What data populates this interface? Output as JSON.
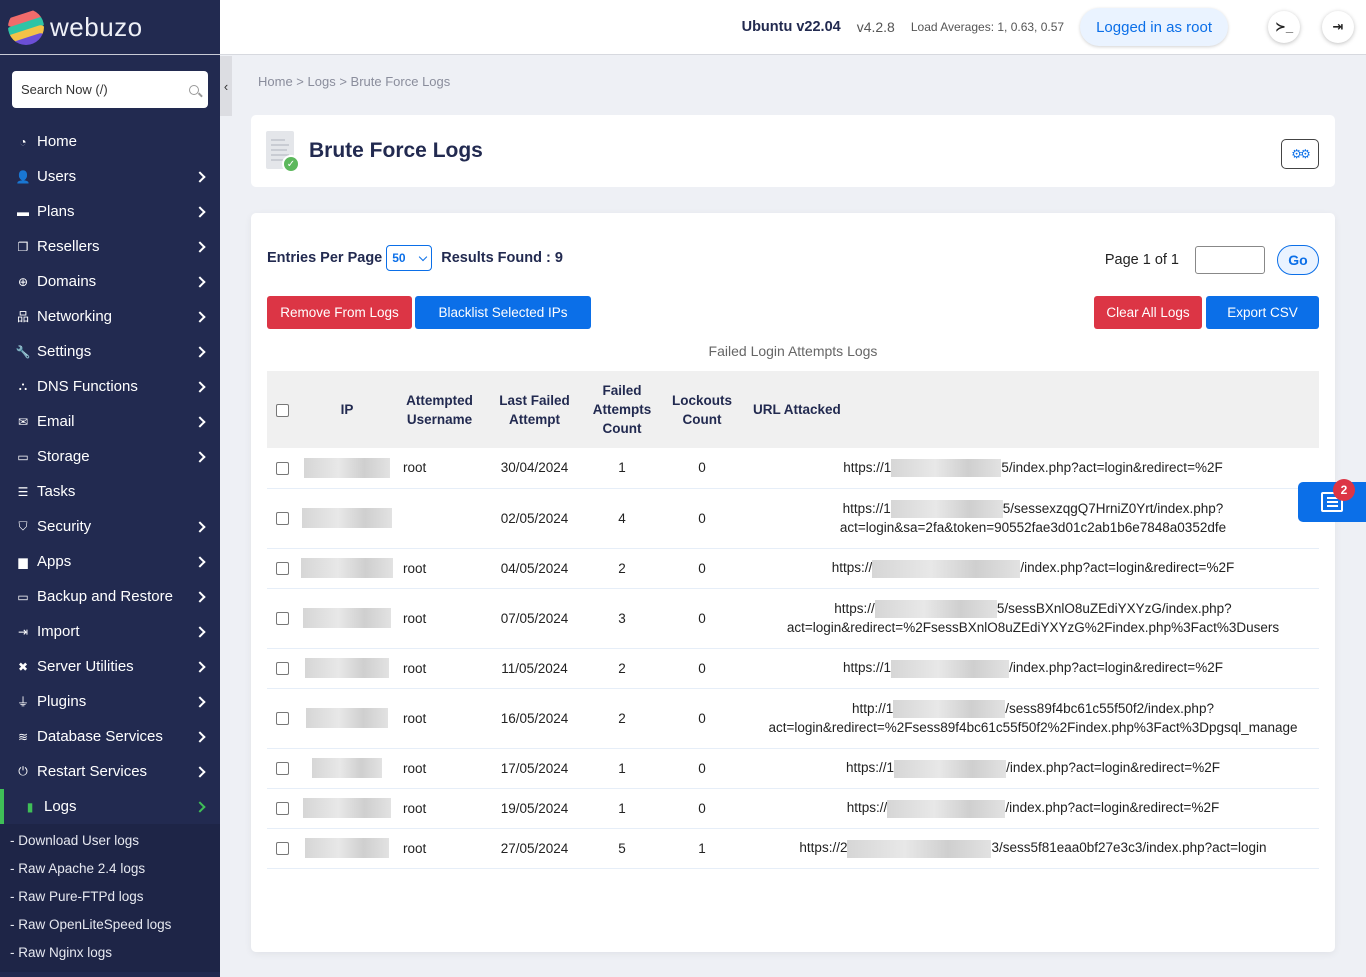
{
  "brand": {
    "name": "webuzo"
  },
  "sidebar": {
    "search_placeholder": "Search Now (/)",
    "items": [
      {
        "label": "Home",
        "icon": "dashboard-icon",
        "glyph": "◔",
        "has_children": false
      },
      {
        "label": "Users",
        "icon": "user-icon",
        "glyph": "👤",
        "has_children": true
      },
      {
        "label": "Plans",
        "icon": "book-icon",
        "glyph": "▬",
        "has_children": true
      },
      {
        "label": "Resellers",
        "icon": "clone-icon",
        "glyph": "❐",
        "has_children": true
      },
      {
        "label": "Domains",
        "icon": "globe-icon",
        "glyph": "⊕",
        "has_children": true
      },
      {
        "label": "Networking",
        "icon": "network-icon",
        "glyph": "品",
        "has_children": true
      },
      {
        "label": "Settings",
        "icon": "wrench-icon",
        "glyph": "🔧",
        "has_children": true
      },
      {
        "label": "DNS Functions",
        "icon": "dns-icon",
        "glyph": "⛬",
        "has_children": true
      },
      {
        "label": "Email",
        "icon": "envelope-icon",
        "glyph": "✉",
        "has_children": true
      },
      {
        "label": "Storage",
        "icon": "hdd-icon",
        "glyph": "▭",
        "has_children": true
      },
      {
        "label": "Tasks",
        "icon": "list-icon",
        "glyph": "☰",
        "has_children": false
      },
      {
        "label": "Security",
        "icon": "shield-icon",
        "glyph": "⛉",
        "has_children": true
      },
      {
        "label": "Apps",
        "icon": "box-icon",
        "glyph": "▆",
        "has_children": true
      },
      {
        "label": "Backup and Restore",
        "icon": "hdd-icon",
        "glyph": "▭",
        "has_children": true
      },
      {
        "label": "Import",
        "icon": "import-icon",
        "glyph": "⇥",
        "has_children": true
      },
      {
        "label": "Server Utilities",
        "icon": "tools-icon",
        "glyph": "✖",
        "has_children": true
      },
      {
        "label": "Plugins",
        "icon": "plug-icon",
        "glyph": "⏚",
        "has_children": true
      },
      {
        "label": "Database Services",
        "icon": "database-icon",
        "glyph": "≋",
        "has_children": true
      },
      {
        "label": "Restart Services",
        "icon": "power-icon",
        "glyph": "⏻",
        "has_children": true
      },
      {
        "label": "Logs",
        "icon": "logbook-icon",
        "glyph": "▮",
        "has_children": true,
        "active": true
      }
    ],
    "sub_items": [
      "- Download User logs",
      "- Raw Apache 2.4 logs",
      "- Raw Pure-FTPd logs",
      "- Raw OpenLiteSpeed logs",
      "- Raw Nginx logs"
    ]
  },
  "topbar": {
    "os": "Ubuntu v22.04",
    "version": "v4.2.8",
    "load": "Load Averages: 1, 0.63, 0.57",
    "logged_in": "Logged in as root",
    "terminal_glyph": "≻_",
    "logout_glyph": "⇥"
  },
  "breadcrumb": [
    "Home",
    "Logs",
    "Brute Force Logs"
  ],
  "breadcrumb_sep": " > ",
  "page": {
    "title": "Brute Force Logs",
    "settings_glyph": "⚙⚙"
  },
  "controls": {
    "entries_label": "Entries Per Page",
    "entries_value": "50",
    "results_label": "Results Found : 9",
    "page_label": "Page 1 of 1",
    "page_input_value": "",
    "go_label": "Go",
    "remove_label": "Remove From Logs",
    "blacklist_label": "Blacklist Selected IPs",
    "clear_label": "Clear All Logs",
    "export_label": "Export CSV"
  },
  "table": {
    "caption": "Failed Login Attempts Logs",
    "headers": {
      "ip": "IP",
      "username": "Attempted Username",
      "last": "Last Failed Attempt",
      "failed": "Failed Attempts Count",
      "lockouts": "Lockouts Count",
      "url": "URL Attacked"
    },
    "rows": [
      {
        "ip": "[redacted]",
        "username": "root",
        "last": "30/04/2024",
        "failed": "1",
        "lockouts": "0",
        "url_prefix": "https://1",
        "url_suffix": "5/index.php?act=login&redirect=%2F",
        "url_line2": ""
      },
      {
        "ip": "[redacted]",
        "username": "",
        "last": "02/05/2024",
        "failed": "4",
        "lockouts": "0",
        "url_prefix": "https://1",
        "url_suffix": "5/sessexzqgQ7HrniZ0Yrt/index.php?",
        "url_line2": "act=login&sa=2fa&token=90552fae3d01c2ab1b6e7848a0352dfe"
      },
      {
        "ip": "[redacted]",
        "username": "root",
        "last": "04/05/2024",
        "failed": "2",
        "lockouts": "0",
        "url_prefix": "https://",
        "url_suffix": "/index.php?act=login&redirect=%2F",
        "url_line2": ""
      },
      {
        "ip": "[redacted]",
        "username": "root",
        "last": "07/05/2024",
        "failed": "3",
        "lockouts": "0",
        "url_prefix": "https://",
        "url_suffix": "5/sessBXnlO8uZEdiYXYzG/index.php?",
        "url_line2": "act=login&redirect=%2FsessBXnlO8uZEdiYXYzG%2Findex.php%3Fact%3Dusers"
      },
      {
        "ip": "[redacted]",
        "username": "root",
        "last": "11/05/2024",
        "failed": "2",
        "lockouts": "0",
        "url_prefix": "https://1",
        "url_suffix": "/index.php?act=login&redirect=%2F",
        "url_line2": ""
      },
      {
        "ip": "[redacted]",
        "username": "root",
        "last": "16/05/2024",
        "failed": "2",
        "lockouts": "0",
        "url_prefix": "http://1",
        "url_suffix": "/sess89f4bc61c55f50f2/index.php?",
        "url_line2": "act=login&redirect=%2Fsess89f4bc61c55f50f2%2Findex.php%3Fact%3Dpgsql_manage"
      },
      {
        "ip": "[redacted]",
        "username": "root",
        "last": "17/05/2024",
        "failed": "1",
        "lockouts": "0",
        "url_prefix": "https://1",
        "url_suffix": "/index.php?act=login&redirect=%2F",
        "url_line2": ""
      },
      {
        "ip": "[redacted]",
        "username": "root",
        "last": "19/05/2024",
        "failed": "1",
        "lockouts": "0",
        "url_prefix": "https://",
        "url_suffix": "/index.php?act=login&redirect=%2F",
        "url_line2": ""
      },
      {
        "ip": "[redacted]",
        "username": "root",
        "last": "27/05/2024",
        "failed": "5",
        "lockouts": "1",
        "url_prefix": "https://2",
        "url_suffix": "3/sess5f81eaa0bf27e3c3/index.php?act=login",
        "url_line2": ""
      }
    ]
  },
  "news": {
    "badge_count": "2"
  },
  "colors": {
    "sidebar_bg": "#222a50",
    "accent_blue": "#0b6fe8",
    "danger_red": "#dc3545",
    "active_green": "#3fbf57"
  }
}
